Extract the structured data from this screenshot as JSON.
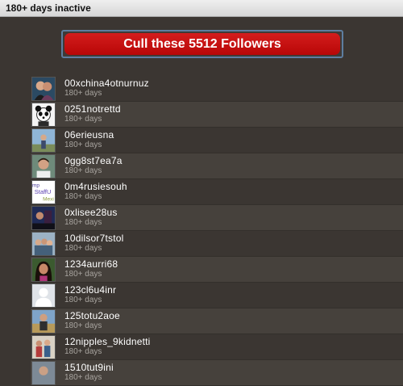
{
  "window": {
    "title": "180+ days inactive"
  },
  "cull_button": {
    "label": "Cull these 5512 Followers"
  },
  "followers": [
    {
      "username": "00xchina4otnurnuz",
      "status": "180+ days",
      "avatar": "photo-couple-icon"
    },
    {
      "username": "0251notrettd",
      "status": "180+ days",
      "avatar": "panda-icon"
    },
    {
      "username": "06erieusna",
      "status": "180+ days",
      "avatar": "photo-person-outdoor-icon"
    },
    {
      "username": "0gg8st7ea7a",
      "status": "180+ days",
      "avatar": "photo-man-icon"
    },
    {
      "username": "0m4rusiesouh",
      "status": "180+ days",
      "avatar": "staff-logo-icon"
    },
    {
      "username": "0xlisee28us",
      "status": "180+ days",
      "avatar": "photo-dark-scene-icon"
    },
    {
      "username": "10dilsor7tstol",
      "status": "180+ days",
      "avatar": "photo-group-icon"
    },
    {
      "username": "1234aurri68",
      "status": "180+ days",
      "avatar": "photo-woman-icon"
    },
    {
      "username": "123cl6u4inr",
      "status": "180+ days",
      "avatar": "default-profile-icon"
    },
    {
      "username": "125totu2aoe",
      "status": "180+ days",
      "avatar": "photo-man-outdoor-icon"
    },
    {
      "username": "12nipples_9kidnetti",
      "status": "180+ days",
      "avatar": "photo-family-icon"
    },
    {
      "username": "1510tut9ini",
      "status": "180+ days",
      "avatar": "photo-partial-icon"
    }
  ]
}
